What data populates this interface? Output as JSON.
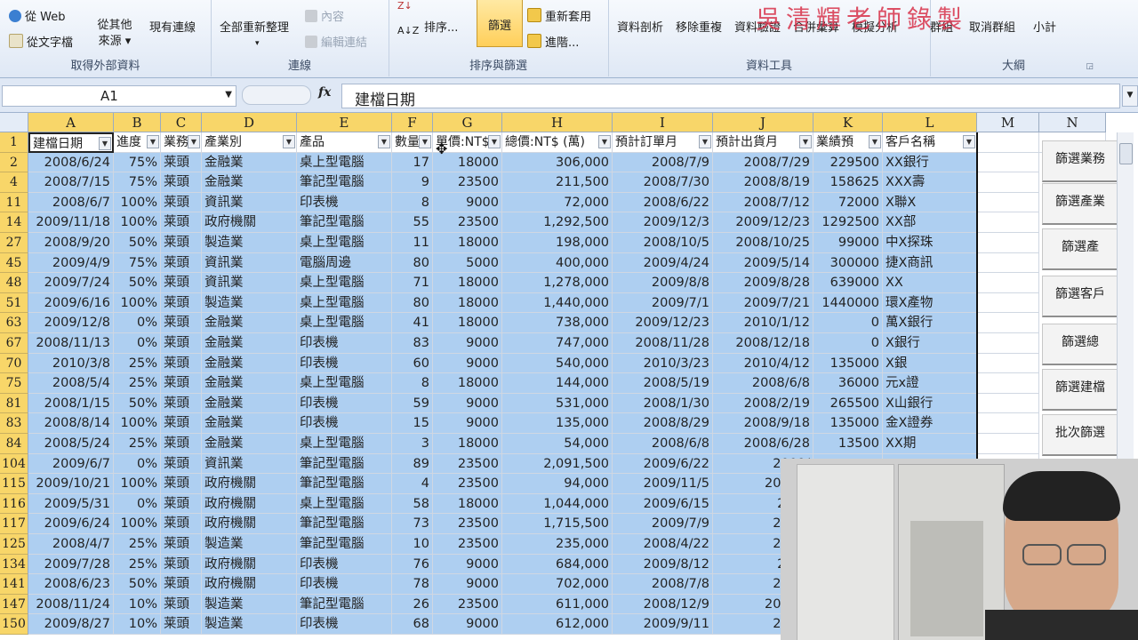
{
  "ribbon": {
    "groups": [
      {
        "label": "取得外部資料",
        "items": [
          "從 Web",
          "從文字檔",
          "從其他來源",
          "現有連線"
        ]
      },
      {
        "label": "連線",
        "items": [
          "全部重新整理",
          "內容",
          "編輯連結"
        ]
      },
      {
        "label": "排序與篩選",
        "items": [
          "排序...",
          "篩選",
          "重新套用",
          "進階..."
        ]
      },
      {
        "label": "資料工具",
        "items": [
          "資料剖析",
          "移除重複",
          "資料驗證",
          "合併彙算",
          "模擬分析"
        ]
      },
      {
        "label": "大綱",
        "items": [
          "群組",
          "取消群組",
          "小計"
        ]
      }
    ],
    "watermark": "吳清輝老師錄製"
  },
  "formula_bar": {
    "name_box": "A1",
    "fx": "fx",
    "formula": "建檔日期"
  },
  "columns": [
    "A",
    "B",
    "C",
    "D",
    "E",
    "F",
    "G",
    "H",
    "I",
    "J",
    "K",
    "L",
    "M",
    "N"
  ],
  "header_row": {
    "row_number": "1",
    "cells": [
      "建檔日期",
      "進度",
      "業務",
      "產業別",
      "產品",
      "數量",
      "單價:NT$",
      "總價:NT$ (萬)",
      "預計訂單月",
      "預計出貨月",
      "業績預",
      "客戶名稱"
    ]
  },
  "rows": [
    {
      "n": "2",
      "v": [
        "2008/6/24",
        "75%",
        "莱頭",
        "金融業",
        "桌上型電腦",
        "17",
        "18000",
        "306,000",
        "2008/7/9",
        "2008/7/29",
        "229500",
        "XX銀行"
      ]
    },
    {
      "n": "4",
      "v": [
        "2008/7/15",
        "75%",
        "莱頭",
        "金融業",
        "筆記型電腦",
        "9",
        "23500",
        "211,500",
        "2008/7/30",
        "2008/8/19",
        "158625",
        "XXX壽"
      ]
    },
    {
      "n": "11",
      "v": [
        "2008/6/7",
        "100%",
        "莱頭",
        "資訊業",
        "印表機",
        "8",
        "9000",
        "72,000",
        "2008/6/22",
        "2008/7/12",
        "72000",
        "X聯X"
      ]
    },
    {
      "n": "14",
      "v": [
        "2009/11/18",
        "100%",
        "莱頭",
        "政府機關",
        "筆記型電腦",
        "55",
        "23500",
        "1,292,500",
        "2009/12/3",
        "2009/12/23",
        "1292500",
        "XX部"
      ]
    },
    {
      "n": "27",
      "v": [
        "2008/9/20",
        "50%",
        "莱頭",
        "製造業",
        "桌上型電腦",
        "11",
        "18000",
        "198,000",
        "2008/10/5",
        "2008/10/25",
        "99000",
        "中X探珠"
      ]
    },
    {
      "n": "45",
      "v": [
        "2009/4/9",
        "75%",
        "莱頭",
        "資訊業",
        "電腦周邊",
        "80",
        "5000",
        "400,000",
        "2009/4/24",
        "2009/5/14",
        "300000",
        "捷X商訊"
      ]
    },
    {
      "n": "48",
      "v": [
        "2009/7/24",
        "50%",
        "莱頭",
        "資訊業",
        "桌上型電腦",
        "71",
        "18000",
        "1,278,000",
        "2009/8/8",
        "2009/8/28",
        "639000",
        "XX"
      ]
    },
    {
      "n": "51",
      "v": [
        "2009/6/16",
        "100%",
        "莱頭",
        "製造業",
        "桌上型電腦",
        "80",
        "18000",
        "1,440,000",
        "2009/7/1",
        "2009/7/21",
        "1440000",
        "環X產物"
      ]
    },
    {
      "n": "63",
      "v": [
        "2009/12/8",
        "0%",
        "莱頭",
        "金融業",
        "桌上型電腦",
        "41",
        "18000",
        "738,000",
        "2009/12/23",
        "2010/1/12",
        "0",
        "萬X銀行"
      ]
    },
    {
      "n": "67",
      "v": [
        "2008/11/13",
        "0%",
        "莱頭",
        "金融業",
        "印表機",
        "83",
        "9000",
        "747,000",
        "2008/11/28",
        "2008/12/18",
        "0",
        "X銀行"
      ]
    },
    {
      "n": "70",
      "v": [
        "2010/3/8",
        "25%",
        "莱頭",
        "金融業",
        "印表機",
        "60",
        "9000",
        "540,000",
        "2010/3/23",
        "2010/4/12",
        "135000",
        "X銀"
      ]
    },
    {
      "n": "75",
      "v": [
        "2008/5/4",
        "25%",
        "莱頭",
        "金融業",
        "桌上型電腦",
        "8",
        "18000",
        "144,000",
        "2008/5/19",
        "2008/6/8",
        "36000",
        "元x證"
      ]
    },
    {
      "n": "81",
      "v": [
        "2008/1/15",
        "50%",
        "莱頭",
        "金融業",
        "印表機",
        "59",
        "9000",
        "531,000",
        "2008/1/30",
        "2008/2/19",
        "265500",
        "X山銀行"
      ]
    },
    {
      "n": "83",
      "v": [
        "2008/8/14",
        "100%",
        "莱頭",
        "金融業",
        "印表機",
        "15",
        "9000",
        "135,000",
        "2008/8/29",
        "2008/9/18",
        "135000",
        "金X證券"
      ]
    },
    {
      "n": "84",
      "v": [
        "2008/5/24",
        "25%",
        "莱頭",
        "金融業",
        "桌上型電腦",
        "3",
        "18000",
        "54,000",
        "2008/6/8",
        "2008/6/28",
        "13500",
        "XX期"
      ]
    },
    {
      "n": "104",
      "v": [
        "2009/6/7",
        "0%",
        "莱頭",
        "資訊業",
        "筆記型電腦",
        "89",
        "23500",
        "2,091,500",
        "2009/6/22",
        "2009/",
        "",
        ""
      ]
    },
    {
      "n": "115",
      "v": [
        "2009/10/21",
        "100%",
        "莱頭",
        "政府機關",
        "筆記型電腦",
        "4",
        "23500",
        "94,000",
        "2009/11/5",
        "2009/1",
        "",
        ""
      ]
    },
    {
      "n": "116",
      "v": [
        "2009/5/31",
        "0%",
        "莱頭",
        "政府機關",
        "桌上型電腦",
        "58",
        "18000",
        "1,044,000",
        "2009/6/15",
        "2009",
        "",
        ""
      ]
    },
    {
      "n": "117",
      "v": [
        "2009/6/24",
        "100%",
        "莱頭",
        "政府機關",
        "筆記型電腦",
        "73",
        "23500",
        "1,715,500",
        "2009/7/9",
        "2009/",
        "",
        ""
      ]
    },
    {
      "n": "125",
      "v": [
        "2008/4/7",
        "25%",
        "莱頭",
        "製造業",
        "筆記型電腦",
        "10",
        "23500",
        "235,000",
        "2008/4/22",
        "2008/",
        "",
        ""
      ]
    },
    {
      "n": "134",
      "v": [
        "2009/7/28",
        "25%",
        "莱頭",
        "政府機關",
        "印表機",
        "76",
        "9000",
        "684,000",
        "2009/8/12",
        "2009",
        "",
        ""
      ]
    },
    {
      "n": "141",
      "v": [
        "2008/6/23",
        "50%",
        "莱頭",
        "政府機關",
        "印表機",
        "78",
        "9000",
        "702,000",
        "2008/7/8",
        "2008/",
        "",
        ""
      ]
    },
    {
      "n": "147",
      "v": [
        "2008/11/24",
        "10%",
        "莱頭",
        "製造業",
        "筆記型電腦",
        "26",
        "23500",
        "611,000",
        "2008/12/9",
        "2008/1",
        "",
        ""
      ]
    },
    {
      "n": "150",
      "v": [
        "2009/8/27",
        "10%",
        "莱頭",
        "製造業",
        "印表機",
        "68",
        "9000",
        "612,000",
        "2009/9/11",
        "2009/",
        "",
        ""
      ]
    }
  ],
  "side_buttons": [
    "篩選業務",
    "篩選產業",
    "篩選產",
    "篩選客戶",
    "篩選總",
    "篩選建檔",
    "批次篩選"
  ]
}
